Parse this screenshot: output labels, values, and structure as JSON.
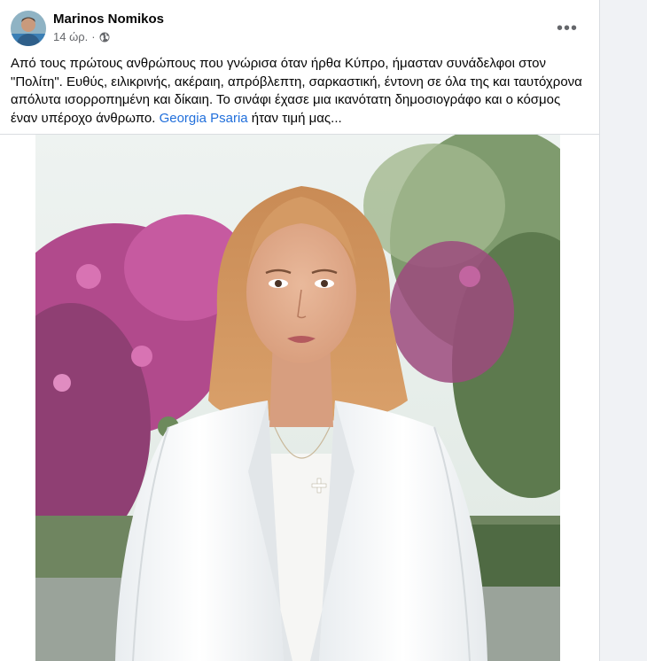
{
  "post": {
    "author_name": "Marinos Nomikos",
    "time": "14 ώρ.",
    "separator": "·",
    "more_label": "•••",
    "text_part1": "Από τους πρώτους ανθρώπους που γνώρισα όταν ήρθα Κύπρο, ήμασταν συνάδελφοι στον \"Πολίτη\". Ευθύς, ειλικρινής, ακέραιη, απρόβλεπτη, σαρκαστική, έντονη σε όλα της και ταυτόχρονα απόλυτα ισορροπημένη και δίκαιη. Το σινάφι έχασε μια ικανότατη δημοσιογράφο και ο κόσμος έναν υπέροχο άνθρωπο. ",
    "mention": "Georgia Psaria",
    "text_part2": " ήταν τιμή μας...",
    "icons": {
      "audience": "globe-icon",
      "options": "more-options-icon"
    }
  },
  "colors": {
    "mention": "#216fdb",
    "secondary_text": "#65676b",
    "page_background": "#f0f2f5"
  }
}
